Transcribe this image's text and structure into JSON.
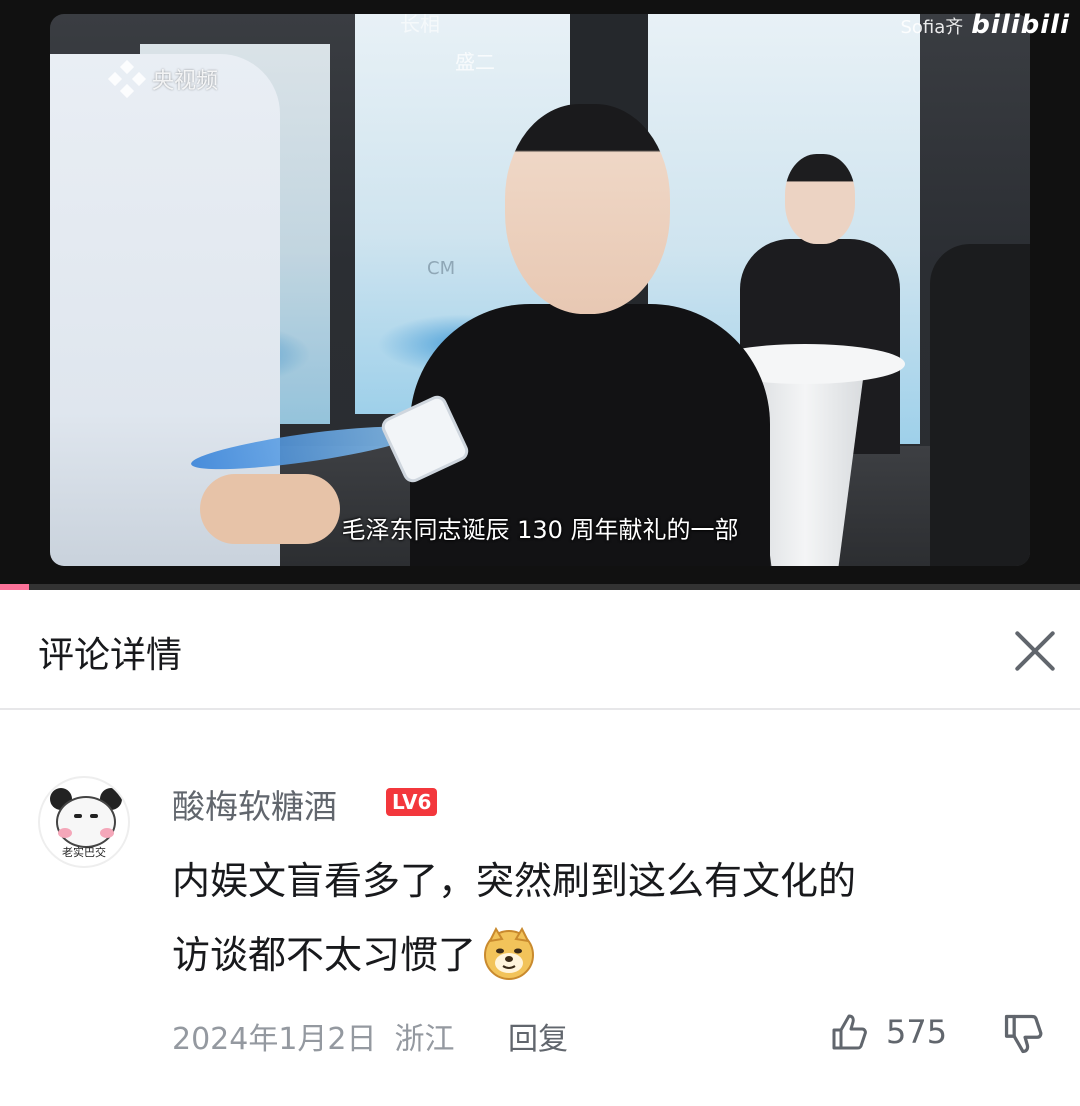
{
  "video": {
    "channel_watermark": "央视频",
    "top_label": "长相",
    "top_label_2": "盛二",
    "uploader": "Sofia齐",
    "platform": "bilibili",
    "subtitle": "毛泽东同志诞辰 130 周年献礼的一部",
    "panel_text": "CM",
    "progress_fraction": 0.027,
    "accent_color": "#fb7299"
  },
  "detail": {
    "title": "评论详情",
    "close_icon": "close-icon"
  },
  "comment": {
    "username": "酸梅软糖酒",
    "level": "LV6",
    "level_color": "#f3373c",
    "avatar_caption": "老实巴交",
    "text_line1": "内娱文盲看多了，突然刷到这么有文化的",
    "text_line2": "访谈都不太习惯了",
    "emoji": "doge-emoji",
    "date": "2024年1月2日",
    "location": "浙江",
    "reply_label": "回复",
    "like_count": "575"
  }
}
